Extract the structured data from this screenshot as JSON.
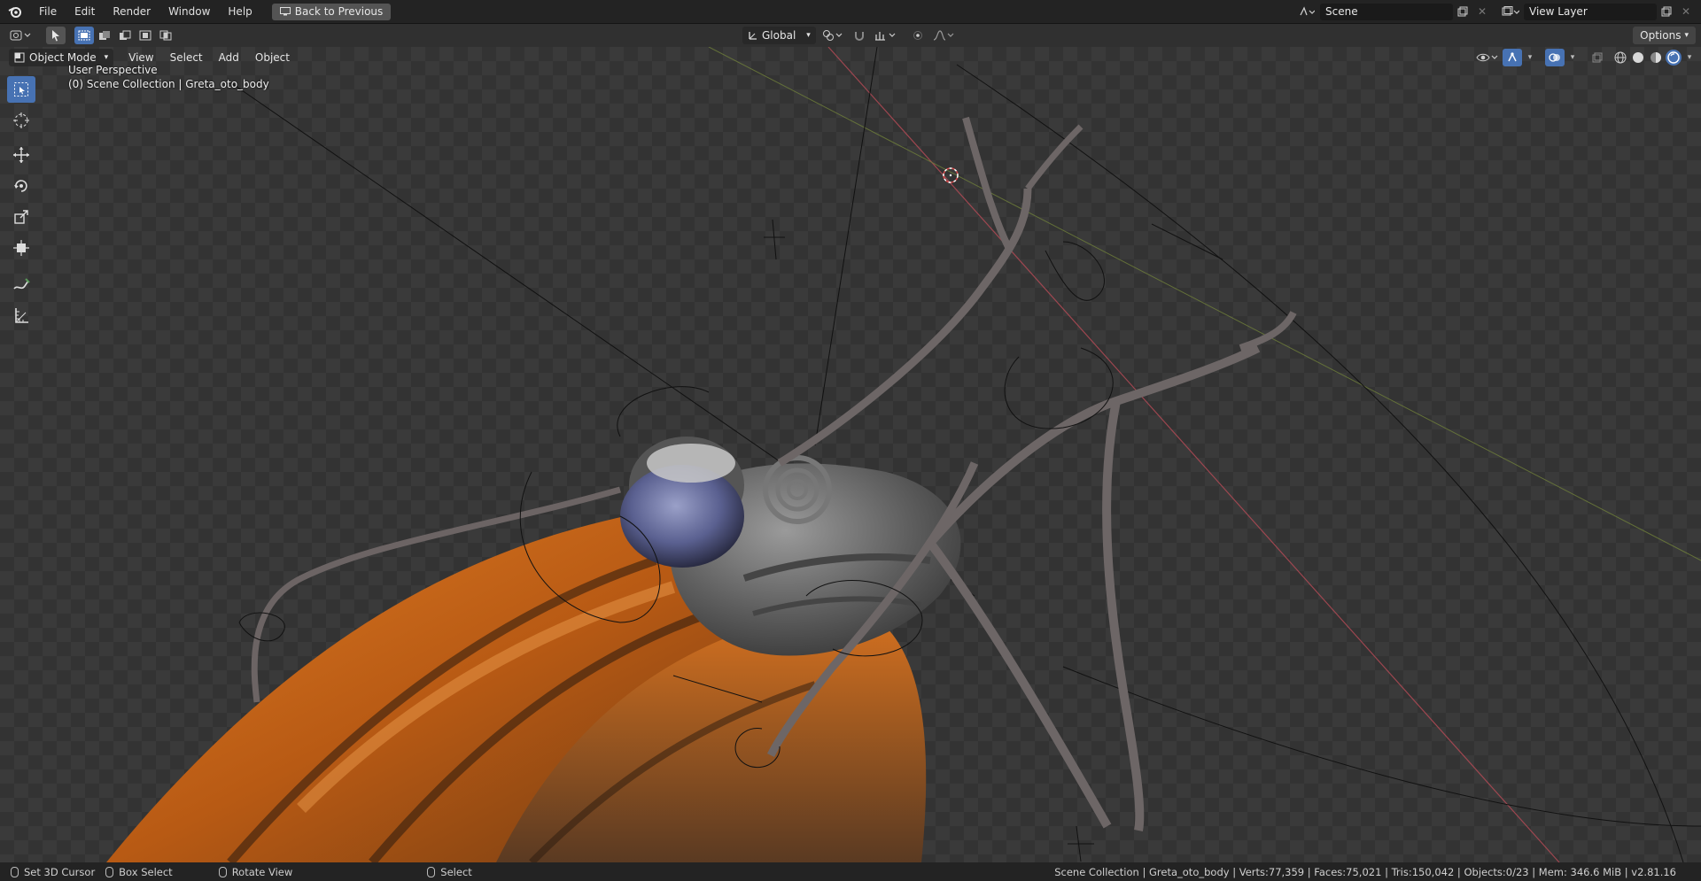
{
  "topbar": {
    "menus": [
      "File",
      "Edit",
      "Render",
      "Window",
      "Help"
    ],
    "back_label": "Back to Previous",
    "scene_name": "Scene",
    "view_layer": "View Layer"
  },
  "toolbar": {
    "orientation": "Global",
    "options_label": "Options"
  },
  "viewport_header": {
    "mode": "Object Mode",
    "menus": [
      "View",
      "Select",
      "Add",
      "Object"
    ]
  },
  "overlay": {
    "perspective": "User Perspective",
    "collection": "(0) Scene Collection | Greta_oto_body"
  },
  "statusbar": {
    "hints": [
      "Set 3D Cursor",
      "Box Select",
      "Rotate View",
      "Select"
    ],
    "stats": "Scene Collection | Greta_oto_body | Verts:77,359 | Faces:75,021 | Tris:150,042 | Objects:0/23 | Mem: 346.6 MiB | v2.81.16"
  },
  "colors": {
    "accent": "#4772b3",
    "wing_orange": "#c8661a",
    "body_gray": "#6b6b6b"
  }
}
